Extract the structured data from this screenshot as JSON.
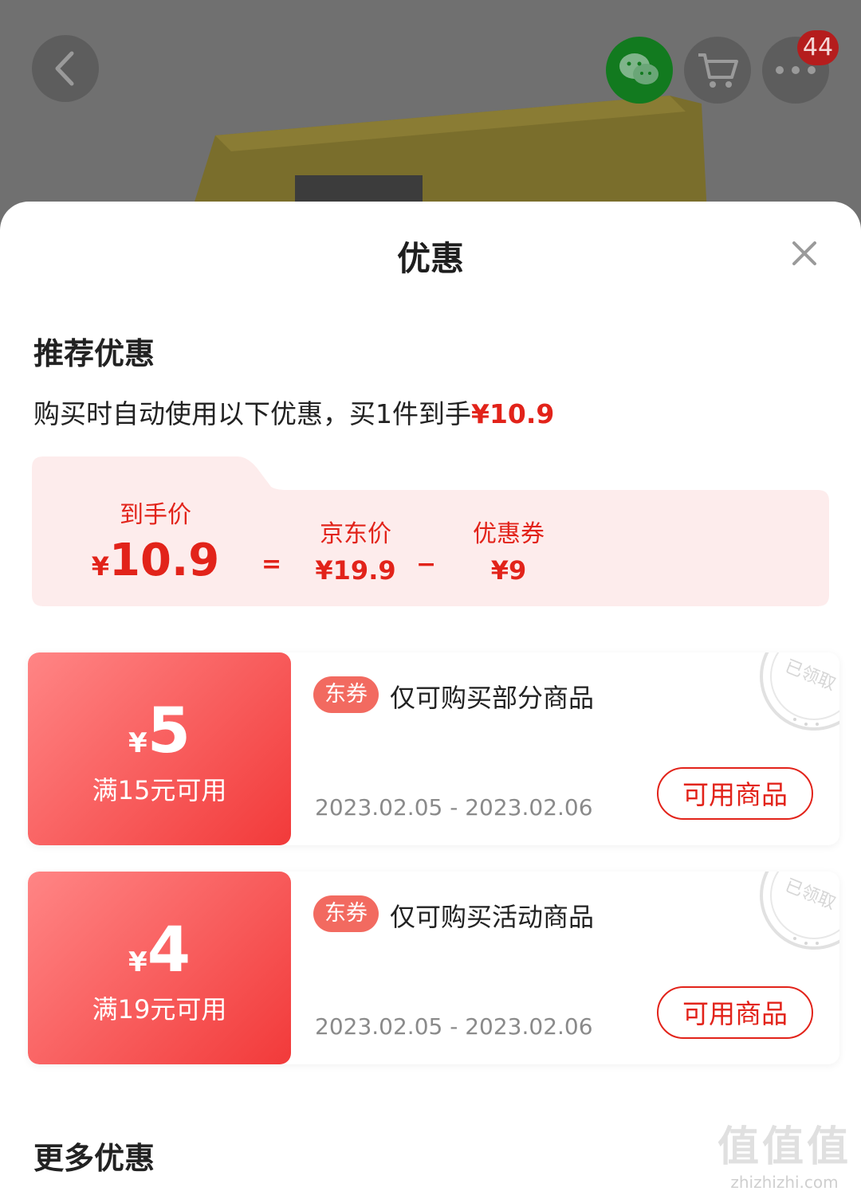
{
  "header": {
    "cart_badge": "44",
    "icons": {
      "back": "chevron-left-icon",
      "share": "wechat-icon",
      "cart": "cart-icon",
      "more": "more-icon"
    }
  },
  "sheet": {
    "title": "优惠",
    "close_icon": "close-icon",
    "recommended": {
      "title": "推荐优惠",
      "desc_prefix": "购买时自动使用以下优惠，买1件到手",
      "desc_price": "¥10.9"
    },
    "breakdown": {
      "final_label": "到手价",
      "final_yen": "¥",
      "final_value": "10.9",
      "equals": "=",
      "jd_label": "京东价",
      "jd_value": "¥19.9",
      "minus": "−",
      "coupon_label": "优惠券",
      "coupon_value": "¥9"
    },
    "coupons": [
      {
        "yen": "¥",
        "amount": "5",
        "condition": "满15元可用",
        "tag": "东券",
        "desc": "仅可购买部分商品",
        "dates": "2023.02.05 - 2023.02.06",
        "button": "可用商品",
        "stamp": "已领取"
      },
      {
        "yen": "¥",
        "amount": "4",
        "condition": "满19元可用",
        "tag": "东券",
        "desc": "仅可购买活动商品",
        "dates": "2023.02.05 - 2023.02.06",
        "button": "可用商品",
        "stamp": "已领取"
      }
    ],
    "more_title": "更多优惠"
  },
  "watermark": {
    "big": "值值值",
    "small": "zhizhizhi.com"
  },
  "colors": {
    "accent": "#e2231a",
    "coupon_gradient_start": "#ff8585",
    "coupon_gradient_end": "#f23a3a",
    "tag": "#f26a60"
  }
}
